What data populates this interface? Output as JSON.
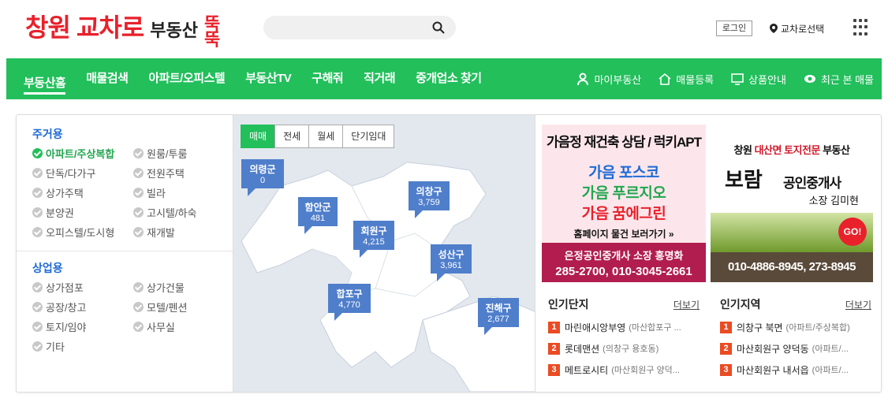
{
  "header": {
    "logo": {
      "part1": "창원",
      "part2": "교차로",
      "part3": "부동산",
      "part4": "뚝뚝"
    },
    "search_placeholder": "",
    "login_label": "로그인",
    "region_label": "교차로선택"
  },
  "nav": {
    "left": [
      "부동산홈",
      "매물검색",
      "아파트/오피스텔",
      "부동산TV",
      "구해줘",
      "직거래",
      "중개업소 찾기"
    ],
    "right": [
      "마이부동산",
      "매물등록",
      "상품안내",
      "최근 본 매물"
    ]
  },
  "categories": {
    "residential_title": "주거용",
    "residential": [
      "아파트/주상복합",
      "원룸/투룸",
      "단독/다가구",
      "전원주택",
      "상가주택",
      "빌라",
      "분양권",
      "고시텔/하숙",
      "오피스텔/도시형",
      "재개발"
    ],
    "commercial_title": "상업용",
    "commercial": [
      "상가점포",
      "상가건물",
      "공장/창고",
      "모텔/펜션",
      "토지/임야",
      "사무실",
      "기타"
    ]
  },
  "map": {
    "tabs": [
      "매매",
      "전세",
      "월세",
      "단기임대"
    ],
    "regions": [
      {
        "name": "의령군",
        "count": "0"
      },
      {
        "name": "함안군",
        "count": "481"
      },
      {
        "name": "의창구",
        "count": "3,759"
      },
      {
        "name": "회원구",
        "count": "4,215"
      },
      {
        "name": "성산구",
        "count": "3,961"
      },
      {
        "name": "합포구",
        "count": "4,770"
      },
      {
        "name": "진해구",
        "count": "2,677"
      }
    ]
  },
  "ad1": {
    "headline": "가음정 재건축 상담 / 럭키APT",
    "lines": [
      "가음 포스코",
      "가음 푸르지오",
      "가음 꿈에그린"
    ],
    "more": "홈페이지 물건 보러가기 »",
    "agent": "은정공인중개사 소장 홍명화",
    "phone": "285-2700, 010-3045-2661"
  },
  "ad2": {
    "head_a": "창원",
    "head_b": "대산면 토지전문",
    "head_c": "부동산",
    "brand": "보람",
    "sub": "공인중개사",
    "ceo": "소장 김미현",
    "go": "GO!",
    "phone": "010-4886-8945, 273-8945"
  },
  "popular_complex": {
    "title": "인기단지",
    "more": "더보기",
    "items": [
      {
        "rank": "1",
        "name": "마린애시앙부영",
        "sub": "(마산합포구 ..."
      },
      {
        "rank": "2",
        "name": "롯데맨션",
        "sub": "(의창구 용호동)"
      },
      {
        "rank": "3",
        "name": "메트로시티",
        "sub": "(마산회원구 양덕..."
      }
    ]
  },
  "popular_area": {
    "title": "인기지역",
    "more": "더보기",
    "items": [
      {
        "rank": "1",
        "name": "의창구 북면",
        "sub": "(아파트/주상복합)"
      },
      {
        "rank": "2",
        "name": "마산회원구 양덕동",
        "sub": "(아파트/..."
      },
      {
        "rank": "3",
        "name": "마산회원구 내서읍",
        "sub": "(아파트/..."
      }
    ]
  },
  "colors": {
    "brand_green": "#22bf5b",
    "logo_red": "#e8212b",
    "accent_blue": "#1e6ad6",
    "pin_blue": "#4f7ecb",
    "rank_orange": "#ea4b23"
  }
}
